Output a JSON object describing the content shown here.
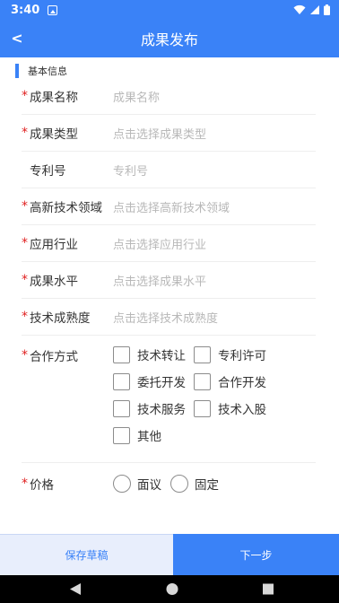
{
  "status": {
    "time": "3:40"
  },
  "header": {
    "title": "成果发布",
    "back_label": "<"
  },
  "section": {
    "label": "基本信息"
  },
  "fields": [
    {
      "label": "成果名称",
      "required": "*",
      "placeholder": "成果名称"
    },
    {
      "label": "成果类型",
      "required": "*",
      "placeholder": "点击选择成果类型"
    },
    {
      "label": "专利号",
      "required": "",
      "placeholder": "专利号"
    },
    {
      "label": "高新技术领域",
      "required": "*",
      "placeholder": "点击选择高新技术领域"
    },
    {
      "label": "应用行业",
      "required": "*",
      "placeholder": "点击选择应用行业"
    },
    {
      "label": "成果水平",
      "required": "*",
      "placeholder": "点击选择成果水平"
    },
    {
      "label": "技术成熟度",
      "required": "*",
      "placeholder": "点击选择技术成熟度"
    }
  ],
  "cooperation": {
    "label": "合作方式",
    "required": "*",
    "options": [
      "技术转让",
      "专利许可",
      "委托开发",
      "合作开发",
      "技术服务",
      "技术入股",
      "其他"
    ]
  },
  "price": {
    "label": "价格",
    "required": "*",
    "options": [
      "面议",
      "固定"
    ]
  },
  "footer": {
    "save_draft": "保存草稿",
    "next": "下一步"
  },
  "colors": {
    "primary": "#3a82f7",
    "required": "#e02020",
    "placeholder": "#b8b8b8",
    "draft_bg": "#e8eefc"
  }
}
